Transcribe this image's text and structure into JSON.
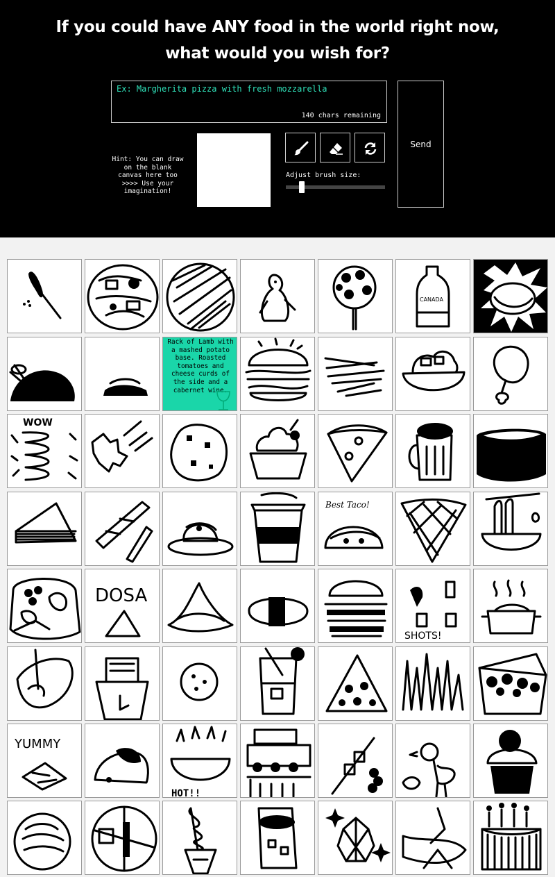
{
  "header": {
    "title_line1": "If you could have ANY food in the world right now,",
    "title_line2": "what would you wish for?"
  },
  "wish_input": {
    "placeholder": "Ex: Margherita pizza with fresh mozzarella",
    "remaining": "140 chars remaining"
  },
  "hint": "Hint: You can draw on the blank canvas here too >>>> Use your imagination!",
  "tools": [
    {
      "name": "brush-icon"
    },
    {
      "name": "eraser-icon"
    },
    {
      "name": "refresh-icon"
    }
  ],
  "brush": {
    "label": "Adjust brush size:",
    "level": 0.14
  },
  "send_label": "Send",
  "gallery": {
    "tiles": [
      {
        "id": "corn-dog",
        "caption": ""
      },
      {
        "id": "rice-bowl",
        "caption": ""
      },
      {
        "id": "scribble-circle",
        "caption": ""
      },
      {
        "id": "penguin",
        "caption": ""
      },
      {
        "id": "cake-pop",
        "caption": ""
      },
      {
        "id": "soda-bottle",
        "caption": ""
      },
      {
        "id": "spring-roll",
        "caption": ""
      },
      {
        "id": "roast-chicken",
        "caption": ""
      },
      {
        "id": "pancakes",
        "caption": ""
      },
      {
        "id": "lamb-note",
        "caption": "Rack of Lamb with a mashed potato base. Roasted tomatoes and cheese curds of the side and a cabernet wine."
      },
      {
        "id": "burger",
        "caption": ""
      },
      {
        "id": "fries",
        "caption": ""
      },
      {
        "id": "salad-bowl",
        "caption": ""
      },
      {
        "id": "drumstick",
        "caption": ""
      },
      {
        "id": "wow-noodle",
        "caption": "WOW"
      },
      {
        "id": "leaves",
        "caption": ""
      },
      {
        "id": "cookie",
        "caption": ""
      },
      {
        "id": "sundae",
        "caption": ""
      },
      {
        "id": "pizza-slice",
        "caption": ""
      },
      {
        "id": "beer-mug",
        "caption": ""
      },
      {
        "id": "sushi-roll",
        "caption": ""
      },
      {
        "id": "cake-slice",
        "caption": ""
      },
      {
        "id": "churros",
        "caption": ""
      },
      {
        "id": "plated-dessert",
        "caption": ""
      },
      {
        "id": "coffee-cup",
        "caption": ""
      },
      {
        "id": "taco",
        "caption": "Best Taco!"
      },
      {
        "id": "waffle-cone",
        "caption": ""
      },
      {
        "id": "ramen",
        "caption": ""
      },
      {
        "id": "bento",
        "caption": ""
      },
      {
        "id": "dosa",
        "caption": "DOSA"
      },
      {
        "id": "dumpling",
        "caption": ""
      },
      {
        "id": "nigiri",
        "caption": ""
      },
      {
        "id": "double-burger",
        "caption": ""
      },
      {
        "id": "shots",
        "caption": "SHOTS!"
      },
      {
        "id": "hot-pot",
        "caption": ""
      },
      {
        "id": "steak",
        "caption": ""
      },
      {
        "id": "noodle-cup",
        "caption": ""
      },
      {
        "id": "small-cookie",
        "caption": ""
      },
      {
        "id": "cocktail",
        "caption": ""
      },
      {
        "id": "pizza-wedge",
        "caption": ""
      },
      {
        "id": "grass",
        "caption": ""
      },
      {
        "id": "takeout-box",
        "caption": ""
      },
      {
        "id": "yummy-nachos",
        "caption": "YUMMY"
      },
      {
        "id": "rock-cake",
        "caption": ""
      },
      {
        "id": "hot-soup",
        "caption": "HOT!!"
      },
      {
        "id": "train-dessert",
        "caption": ""
      },
      {
        "id": "skewer",
        "caption": ""
      },
      {
        "id": "bird",
        "caption": ""
      },
      {
        "id": "muffin",
        "caption": ""
      },
      {
        "id": "pie",
        "caption": ""
      },
      {
        "id": "pizza-plate",
        "caption": ""
      },
      {
        "id": "soft-serve",
        "caption": ""
      },
      {
        "id": "burrito",
        "caption": ""
      },
      {
        "id": "artichoke",
        "caption": ""
      },
      {
        "id": "abstract",
        "caption": ""
      },
      {
        "id": "birthday-cake",
        "caption": ""
      }
    ]
  }
}
